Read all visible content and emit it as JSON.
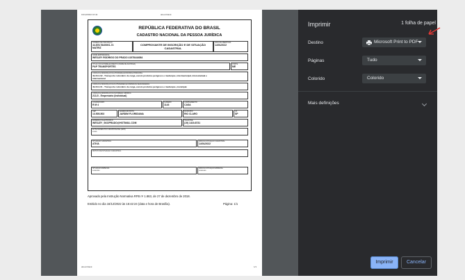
{
  "preview": {
    "header_left": "16/12/2022 16:42",
    "header_center": "about:blank",
    "footer_left": "about:blank",
    "footer_right": "1/1",
    "title_1": "REPÚBLICA FEDERATIVA DO BRASIL",
    "title_2": "CADASTRO NACIONAL DA PESSOA JURÍDICA",
    "fields": {
      "numero_label": "NÚMERO DE INSCRIÇÃO",
      "numero_value": "44.878.784/0001-74",
      "numero_value2": "MATRIZ",
      "comprovante": "COMPROVANTE DE INSCRIÇÃO E DE SITUAÇÃO CADASTRAL",
      "abertura_label": "DATA DE ABERTURA",
      "abertura_value": "14/01/2022",
      "nome_label": "NOME EMPRESARIAL",
      "nome_value": "WESLEY RODRIGO DO PRADO 41978444084",
      "fantasia_label": "TÍTULO DO ESTABELECIMENTO (NOME DE FANTASIA)",
      "fantasia_value": "P&P TRANSPORTES",
      "porte_label": "PORTE",
      "porte_value": "ME",
      "principal_label": "CÓDIGO E DESCRIÇÃO DA ATIVIDADE ECONÔMICA PRINCIPAL",
      "principal_value": "49.30-2-02 - Transporte rodoviário de carga, exceto produtos perigosos e mudanças, intermunicipal, interestadual e",
      "principal_value2": "internacional",
      "secundaria_label": "CÓDIGO E DESCRIÇÃO DAS ATIVIDADES ECONÔMICAS SECUNDÁRIAS",
      "secundaria_value": "49.30-2-01 - Transporte rodoviário de carga, exceto produtos perigosos e mudanças, municipal.",
      "natureza_label": "CÓDIGO E DESCRIÇÃO DA NATUREZA JURÍDICA",
      "natureza_value": "213-5 - Empresário (Individual)",
      "logradouro_label": "LOGRADOURO",
      "logradouro_value": "R M 4",
      "numero_end_label": "NÚMERO",
      "numero_end_value": "1143",
      "complemento_label": "COMPLEMENTO",
      "complemento_value": "CASA",
      "cep_label": "CEP",
      "cep_value": "13.505-503",
      "bairro_label": "BAIRRO/DISTRITO",
      "bairro_value": "JARDIM FLORIDIANA",
      "municipio_label": "MUNICÍPIO",
      "municipio_value": "RIO CLARO",
      "uf_label": "UF",
      "uf_value": "SP",
      "email_label": "ENDEREÇO ELETRÔNICO",
      "email_value": "WESLEY_SKOPRADO@HOTMAIL.COM",
      "telefone_label": "TELEFONE",
      "telefone_value": "(19) 1419-8731",
      "efr_label": "ENTE FEDERATIVO RESPONSÁVEL (EFR)",
      "efr_value": "*****",
      "situacao_label": "SITUAÇÃO CADASTRAL",
      "situacao_value": "ATIVA",
      "data_situacao_label": "DATA DA SITUAÇÃO CADASTRAL",
      "data_situacao_value": "14/01/2022",
      "motivo_label": "MOTIVO DE SITUAÇÃO CADASTRAL",
      "especial_label": "SITUAÇÃO ESPECIAL",
      "especial_value": "********",
      "data_especial_label": "DATA DA SITUAÇÃO ESPECIAL",
      "data_especial_value": "********"
    },
    "approved": "Aprovado pela Instrução Normativa RFB nº 1.863, de 27 de dezembro de 2018.",
    "emitted": "Emitido no dia 16/12/2022 às 16:42:24 (data e hora de Brasília).",
    "page_label": "Página: 1/1"
  },
  "settings": {
    "title": "Imprimir",
    "sheets": "1 folha de papel",
    "destino_label": "Destino",
    "destino_value": "Microsoft Print to PDF",
    "paginas_label": "Páginas",
    "paginas_value": "Tudo",
    "colorido_label": "Colorido",
    "colorido_value": "Colorido",
    "more_label": "Mais definições",
    "print_label": "Imprimir",
    "cancel_label": "Cancelar"
  },
  "colors": {
    "panel_bg": "#292a2d",
    "preview_bg": "#525659",
    "accent": "#8ab4f8",
    "annotation": "#e53935"
  }
}
